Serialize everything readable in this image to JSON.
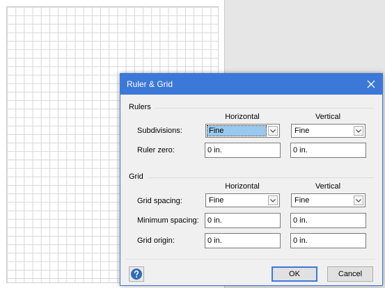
{
  "dialog": {
    "title": "Ruler & Grid",
    "rulers": {
      "section": "Rulers",
      "col_horizontal": "Horizontal",
      "col_vertical": "Vertical",
      "subdivisions_label": "Subdivisions:",
      "subdivisions_h": "Fine",
      "subdivisions_v": "Fine",
      "ruler_zero_label": "Ruler zero:",
      "ruler_zero_h": "0 in.",
      "ruler_zero_v": "0 in."
    },
    "grid": {
      "section": "Grid",
      "col_horizontal": "Horizontal",
      "col_vertical": "Vertical",
      "spacing_label": "Grid spacing:",
      "spacing_h": "Fine",
      "spacing_v": "Fine",
      "min_spacing_label": "Minimum spacing:",
      "min_spacing_h": "0 in.",
      "min_spacing_v": "0 in.",
      "origin_label": "Grid origin:",
      "origin_h": "0 in.",
      "origin_v": "0 in."
    },
    "buttons": {
      "ok": "OK",
      "cancel": "Cancel"
    }
  },
  "icons": {
    "close": "close-icon",
    "help": "help-icon",
    "dropdown": "chevron-down-icon"
  },
  "colors": {
    "accent": "#3c78d8"
  }
}
